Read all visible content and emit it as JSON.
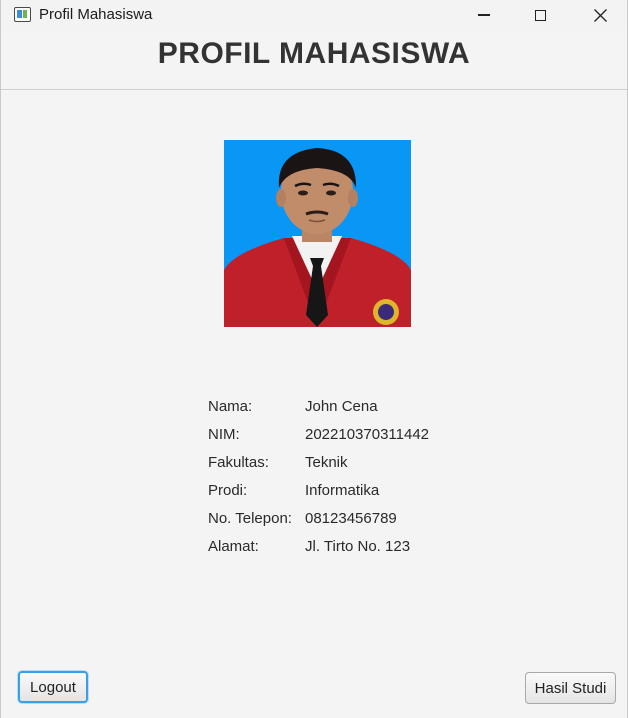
{
  "window": {
    "title": "Profil Mahasiswa",
    "icon": "app-window-icon",
    "controls": [
      "minimize-icon",
      "maximize-icon",
      "close-icon"
    ]
  },
  "header": {
    "title": "PROFIL MAHASISWA"
  },
  "profile": {
    "photo": "student-photo",
    "fields": [
      {
        "label": "Nama:",
        "value": "John Cena"
      },
      {
        "label": "NIM:",
        "value": "202210370311442"
      },
      {
        "label": "Fakultas:",
        "value": "Teknik"
      },
      {
        "label": "Prodi:",
        "value": "Informatika"
      },
      {
        "label": "No. Telepon:",
        "value": "08123456789"
      },
      {
        "label": "Alamat:",
        "value": "Jl. Tirto No. 123"
      }
    ]
  },
  "buttons": {
    "logout": "Logout",
    "hasil_studi": "Hasil Studi"
  },
  "colors": {
    "photo_background": "#0a96f5",
    "jacket": "#c0202a",
    "focus_ring": "#3aa0e4"
  }
}
